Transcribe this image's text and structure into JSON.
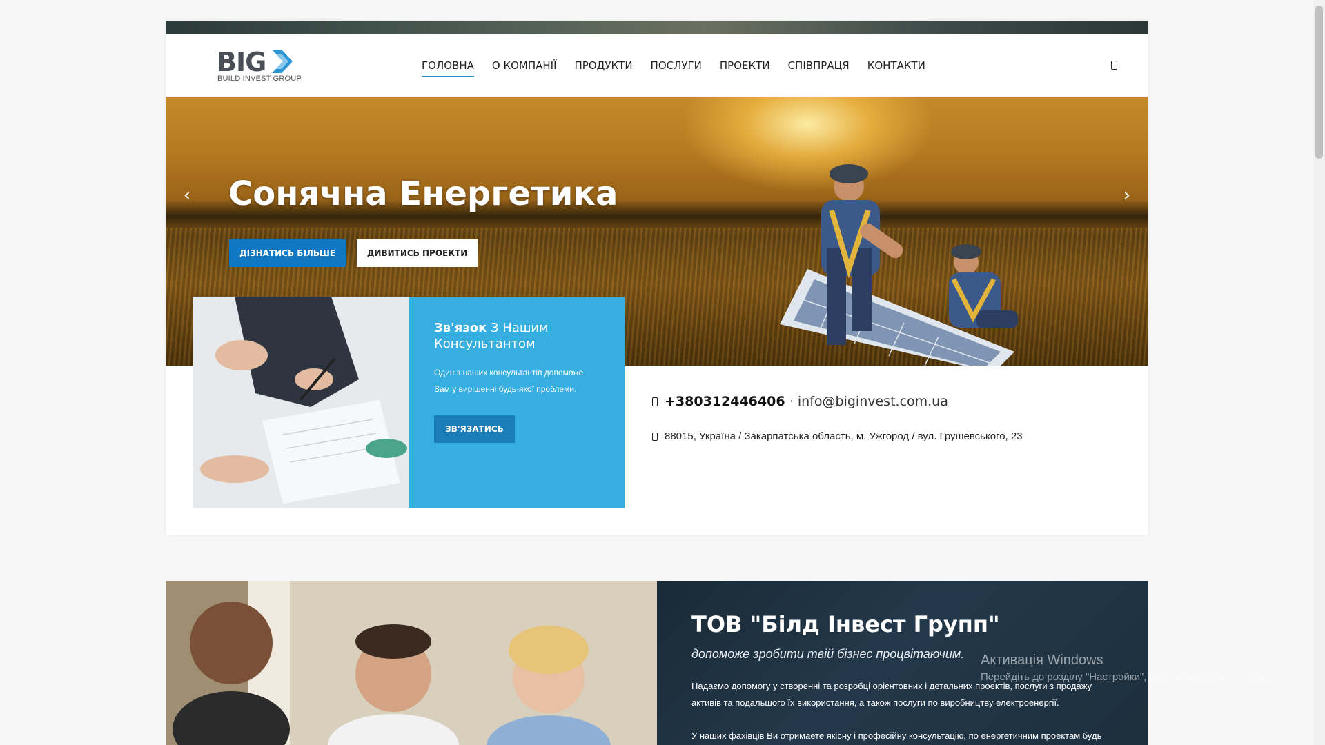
{
  "brand": {
    "logo_text": "BIG",
    "tagline": "BUILD INVEST GROUP",
    "accent_blue": "#1078c2",
    "consult_blue": "#36aee0"
  },
  "nav": {
    "items": [
      {
        "label": "ГОЛОВНА",
        "active": true
      },
      {
        "label": "О КОМПАНІЇ",
        "active": false
      },
      {
        "label": "ПРОДУКТИ",
        "active": false
      },
      {
        "label": "ПОСЛУГИ",
        "active": false
      },
      {
        "label": "ПРОЕКТИ",
        "active": false
      },
      {
        "label": "СПІВПРАЦЯ",
        "active": false
      },
      {
        "label": "КОНТАКТИ",
        "active": false
      }
    ],
    "mobile_icon": "mobile-icon"
  },
  "hero": {
    "title": "Сонячна Енергетика",
    "btn_more": "ДІЗНАТИСЬ БІЛЬШЕ",
    "btn_projects": "ДИВИТИСЬ ПРОЕКТИ",
    "prev_icon": "‹",
    "next_icon": "›"
  },
  "consult": {
    "title_bold": "Зв'язок",
    "title_rest": " З Нашим Консультантом",
    "text": "Один з наших консультантів допоможе Вам у вирішенні будь-якої проблеми.",
    "button": "ЗВ'ЯЗАТИСЬ"
  },
  "contact": {
    "phone": "+380312446406",
    "separator": "·",
    "email": "info@biginvest.com.ua",
    "address": "88015, Україна / Закарпатська область, м. Ужгород / вул. Грушевського, 23"
  },
  "about": {
    "title": "ТОВ \"Білд Інвест Групп\"",
    "slogan": "допоможе зробити твій бізнес процвітаючим.",
    "p1": "Надаємо допомогу у створенні та розробці орієнтовних і детальних проектів, послуги з продажу активів та подальшого їх використання, а також послуги по виробництву електроенергії.",
    "p2": "У наших фахівців Ви отримаете якісну і професійну консультацію, по енергетичним проектам будь"
  },
  "watermark": {
    "line1": "Активація Windows",
    "line2": "Перейдіть до розділу \"Настройки\", щоб активувати Windows."
  }
}
